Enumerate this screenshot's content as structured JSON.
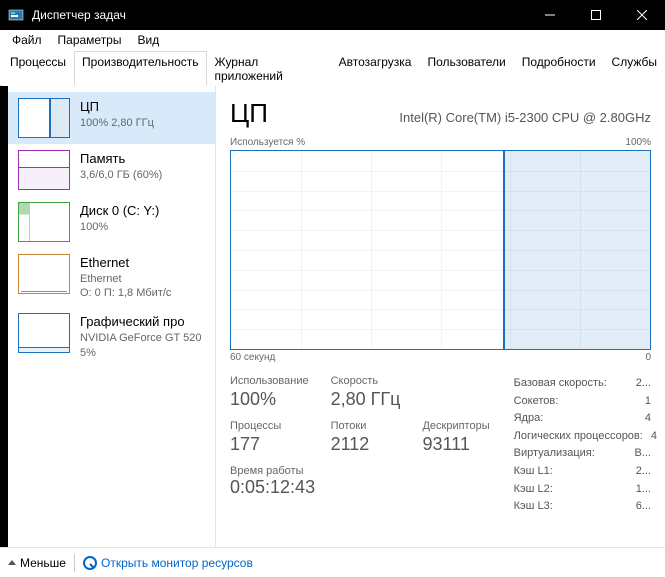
{
  "window": {
    "title": "Диспетчер задач"
  },
  "menu": {
    "file": "Файл",
    "options": "Параметры",
    "view": "Вид"
  },
  "tabs": {
    "processes": "Процессы",
    "performance": "Производительность",
    "app_history": "Журнал приложений",
    "startup": "Автозагрузка",
    "users": "Пользователи",
    "details": "Подробности",
    "services": "Службы"
  },
  "sidebar": {
    "cpu": {
      "title": "ЦП",
      "sub": "100%  2,80 ГГц"
    },
    "mem": {
      "title": "Память",
      "sub": "3,6/6,0 ГБ (60%)"
    },
    "disk": {
      "title": "Диск 0 (C: Y:)",
      "sub": "100%"
    },
    "eth": {
      "title": "Ethernet",
      "sub1": "Ethernet",
      "sub2": "О: 0 П: 1,8 Мбит/с"
    },
    "gpu": {
      "title": "Графический про",
      "sub1": "NVIDIA GeForce GT 520",
      "sub2": "5%"
    }
  },
  "detail": {
    "title": "ЦП",
    "cpu_name": "Intel(R) Core(TM) i5-2300 CPU @ 2.80GHz",
    "chart_top_left": "Используется %",
    "chart_top_right": "100%",
    "chart_bottom_left": "60 секунд",
    "chart_bottom_right": "0",
    "labels": {
      "usage": "Использование",
      "speed": "Скорость",
      "processes": "Процессы",
      "threads": "Потоки",
      "handles": "Дескрипторы",
      "uptime": "Время работы"
    },
    "values": {
      "usage": "100%",
      "speed": "2,80 ГГц",
      "processes": "177",
      "threads": "2112",
      "handles": "93111",
      "uptime": "0:05:12:43"
    },
    "right": {
      "base_speed_k": "Базовая скорость:",
      "base_speed_v": "2...",
      "sockets_k": "Сокетов:",
      "sockets_v": "1",
      "cores_k": "Ядра:",
      "cores_v": "4",
      "logical_k": "Логических процессоров:",
      "logical_v": "4",
      "virt_k": "Виртуализация:",
      "virt_v": "В...",
      "l1_k": "Кэш L1:",
      "l1_v": "2...",
      "l2_k": "Кэш L2:",
      "l2_v": "1...",
      "l3_k": "Кэш L3:",
      "l3_v": "6..."
    }
  },
  "footer": {
    "less": "Меньше",
    "open_monitor": "Открыть монитор ресурсов"
  },
  "chart_data": {
    "type": "area",
    "title": "Используется %",
    "xlabel": "60 секунд",
    "ylabel": "%",
    "xlim": [
      0,
      60
    ],
    "ylim": [
      0,
      100
    ],
    "series": [
      {
        "name": "ЦП",
        "x": [
          60,
          40,
          39,
          38,
          0
        ],
        "values": [
          0,
          0,
          100,
          100,
          100
        ]
      }
    ]
  }
}
